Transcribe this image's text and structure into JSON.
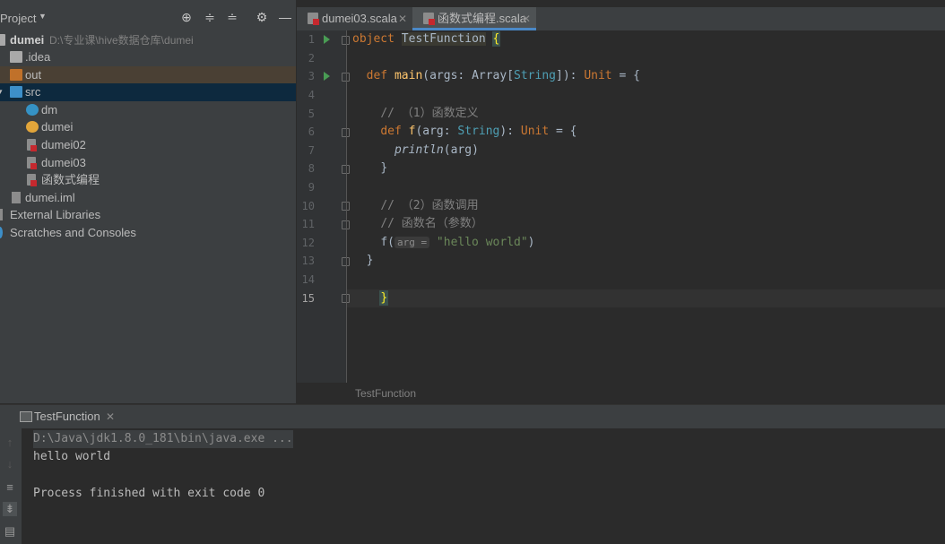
{
  "project": {
    "title": "Project",
    "header_icons": [
      "target-icon",
      "expand-all-icon",
      "collapse-all-icon",
      "gear-icon",
      "minimize-icon"
    ],
    "tree": [
      {
        "label": "dumei",
        "path": "D:\\专业课\\hive数据仓库\\dumei",
        "icon": "module-folder-icon",
        "bold": true
      },
      {
        "label": ".idea",
        "icon": "folder-icon"
      },
      {
        "label": "out",
        "icon": "excluded-folder-icon"
      },
      {
        "label": "src",
        "icon": "source-folder-icon"
      },
      {
        "label": "dm",
        "icon": "scala-class-icon"
      },
      {
        "label": "dumei",
        "icon": "scala-object-icon"
      },
      {
        "label": "dumei02",
        "icon": "scala-file-icon"
      },
      {
        "label": "dumei03",
        "icon": "scala-file-icon"
      },
      {
        "label": "函数式编程",
        "icon": "scala-file-icon"
      },
      {
        "label": "dumei.iml",
        "icon": "iml-file-icon"
      },
      {
        "label": "External Libraries",
        "icon": "libraries-icon"
      },
      {
        "label": "Scratches and Consoles",
        "icon": "scratches-icon"
      }
    ]
  },
  "editor": {
    "tabs": [
      {
        "label": "dumei03.scala",
        "active": false
      },
      {
        "label": "函数式编程.scala",
        "active": true
      }
    ],
    "line_numbers": [
      "1",
      "2",
      "3",
      "4",
      "5",
      "6",
      "7",
      "8",
      "9",
      "10",
      "11",
      "12",
      "13",
      "14",
      "15"
    ],
    "code": {
      "l1_kw": "object",
      "l1_cls": "TestFunction",
      "l1_brace": "{",
      "l3_kw": "def",
      "l3_fn": "main",
      "l3_a": "(args: Array[",
      "l3_typ": "String",
      "l3_b": "]): ",
      "l3_unit": "Unit",
      "l3_c": " = {",
      "l5": "// （1）函数定义",
      "l6_kw": "def",
      "l6_fn": "f",
      "l6_a": "(arg: ",
      "l6_typ": "String",
      "l6_b": "): ",
      "l6_unit": "Unit",
      "l6_c": " = {",
      "l7_fn": "println",
      "l7_a": "(arg)",
      "l8": "}",
      "l10": "// （2）函数调用",
      "l11": "// 函数名（参数）",
      "l12_a": "f(",
      "l12_hint": "arg =",
      "l12_str": "\"hello world\"",
      "l12_b": ")",
      "l13": "}",
      "l15": "}"
    },
    "breadcrumb": "TestFunction"
  },
  "run": {
    "tab_label": "TestFunction",
    "console": [
      "D:\\Java\\jdk1.8.0_181\\bin\\java.exe ...",
      "hello world",
      "",
      "Process finished with exit code 0"
    ],
    "tools": [
      "up-arrow-icon",
      "down-arrow-icon",
      "soft-wrap-icon",
      "scroll-to-end-icon",
      "print-icon"
    ]
  }
}
